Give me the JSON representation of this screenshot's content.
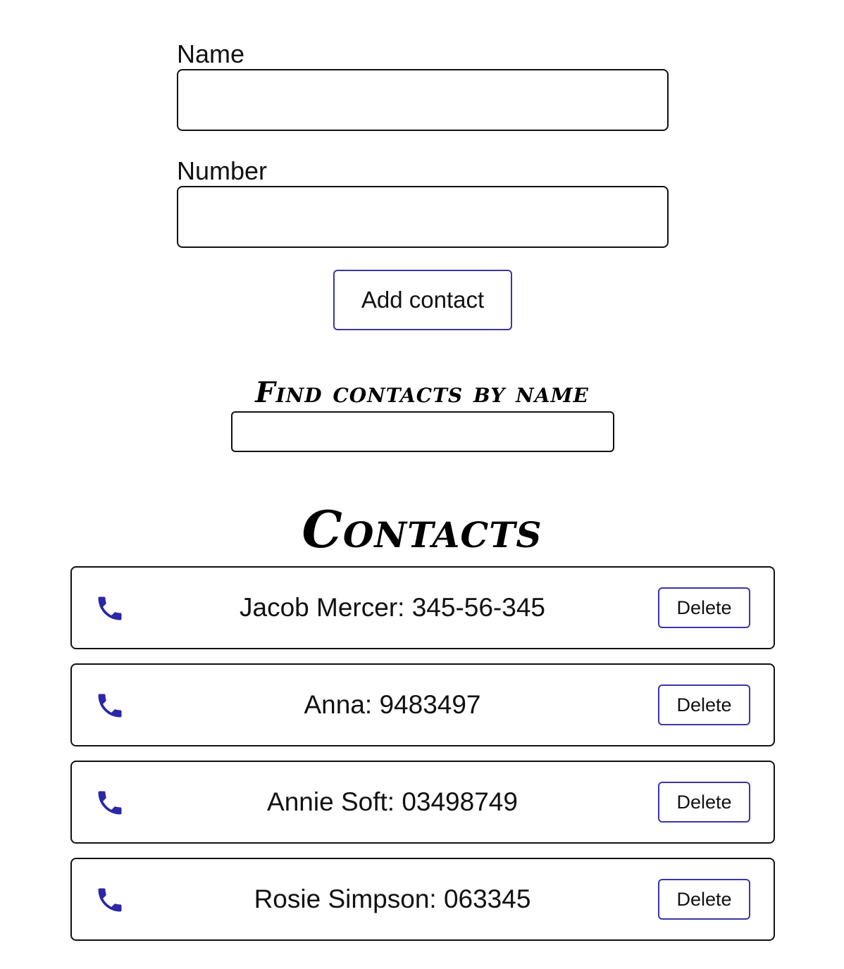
{
  "form": {
    "name_label": "Name",
    "name_value": "",
    "number_label": "Number",
    "number_value": "",
    "submit_label": "Add contact"
  },
  "filter": {
    "title": "Find contacts by name",
    "value": ""
  },
  "contacts": {
    "title": "Contacts",
    "delete_label": "Delete",
    "icon": "phone-icon",
    "icon_color": "#2b27a6",
    "items": [
      {
        "text": "Jacob Mercer: 345-56-345"
      },
      {
        "text": "Anna: 9483497"
      },
      {
        "text": "Annie Soft: 03498749"
      },
      {
        "text": "Rosie Simpson: 063345"
      }
    ]
  },
  "colors": {
    "accent_border": "#3a36a8",
    "text": "#111111",
    "background": "#ffffff"
  }
}
